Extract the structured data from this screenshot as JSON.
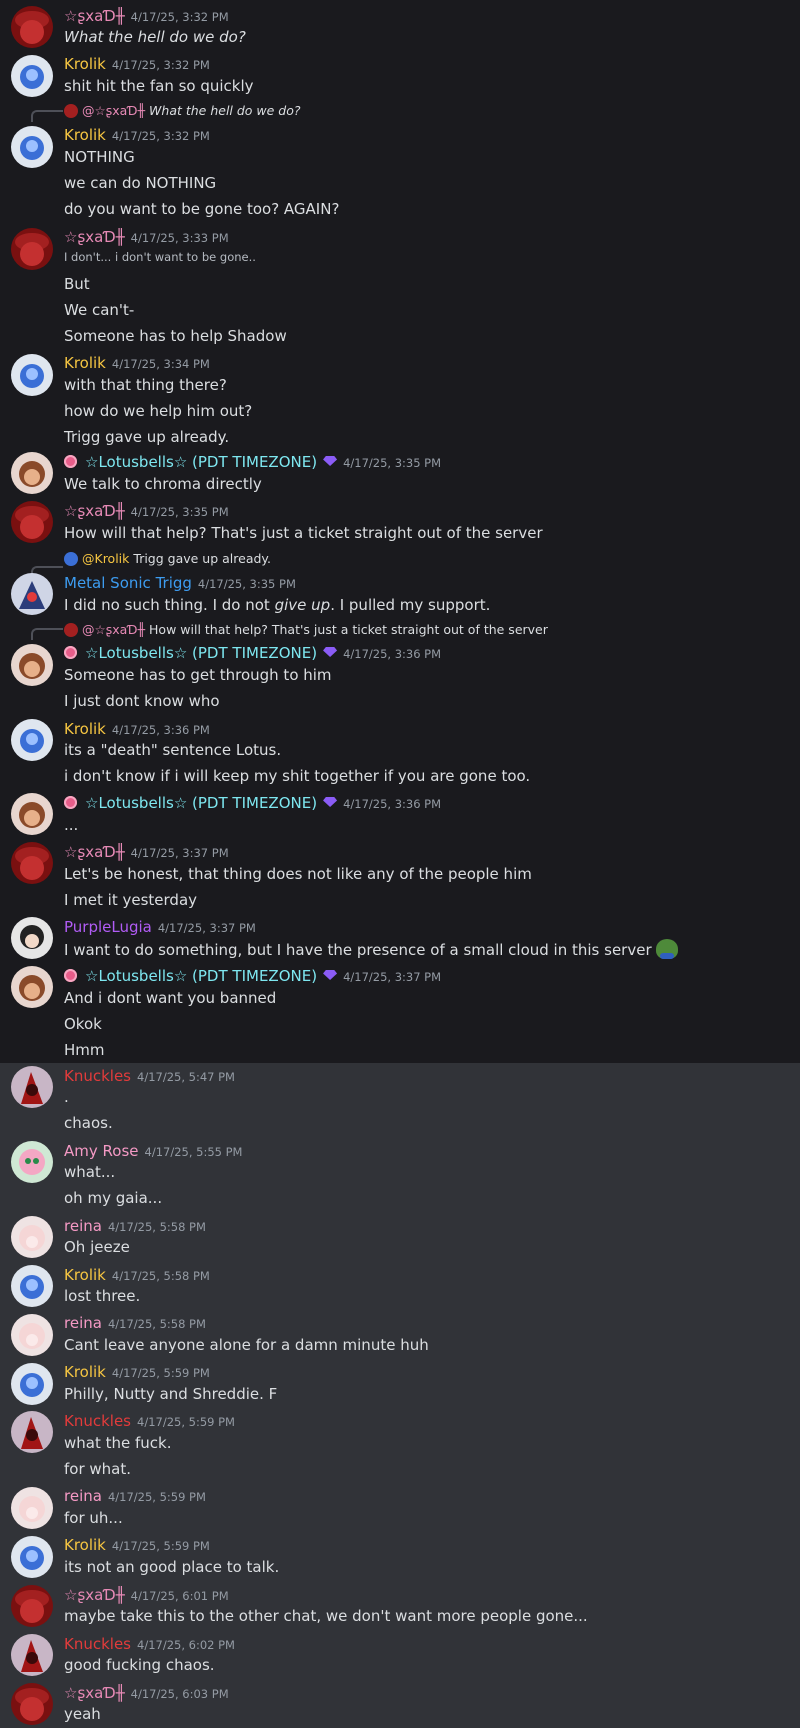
{
  "colors": {
    "background_top": "#1a1a1e",
    "background_bottom": "#313338",
    "sxad": "#e78ab6",
    "krolik": "#f5c542",
    "lotusbells": "#7ee7f0",
    "metal_sonic_trigg": "#3d9cf0",
    "purplelugia": "#b15cf5",
    "knuckles": "#e23b3b",
    "amy_rose": "#f59ac5",
    "reina": "#f59ac5",
    "timestamp": "#949ba4",
    "text": "#dbdee1"
  },
  "messages": [
    {
      "author": "☆ʂxaƊ╫",
      "time": "4/17/25, 3:32 PM",
      "lines": [
        "What the hell do we do?"
      ]
    },
    {
      "author": "Krolik",
      "time": "4/17/25, 3:32 PM",
      "lines": [
        "shit hit the fan so quickly"
      ]
    },
    {
      "reply": {
        "mention": "@☆ʂxaƊ╫",
        "text": "What the hell do we do?"
      },
      "author": "Krolik",
      "time": "4/17/25, 3:32 PM",
      "lines": [
        "NOTHING",
        "we can do NOTHING",
        "do you want to be gone too? AGAIN?"
      ]
    },
    {
      "author": "☆ʂxaƊ╫",
      "time": "4/17/25, 3:33 PM",
      "lines": [
        "I don't... i don't want to be gone..",
        "But",
        "We can't-",
        "Someone has to help Shadow"
      ]
    },
    {
      "author": "Krolik",
      "time": "4/17/25, 3:34 PM",
      "lines": [
        "with that thing there?",
        "how do we help him out?",
        "Trigg gave up already."
      ]
    },
    {
      "author": "☆Lotusbells☆ (PDT TIMEZONE)",
      "time": "4/17/25, 3:35 PM",
      "lines": [
        "We talk to chroma directly"
      ]
    },
    {
      "author": "☆ʂxaƊ╫",
      "time": "4/17/25, 3:35 PM",
      "lines": [
        "How will that help? That's just a ticket straight out of the server"
      ]
    },
    {
      "reply": {
        "mention": "@Krolik",
        "text": "Trigg gave up already."
      },
      "author": "Metal Sonic Trigg",
      "time": "4/17/25, 3:35 PM",
      "lines": [
        "I did no such thing. I do not",
        "give up",
        ". I pulled my support."
      ]
    },
    {
      "reply": {
        "mention": "@☆ʂxaƊ╫",
        "text": "How will that help? That's just a ticket straight out of the server"
      },
      "author": "☆Lotusbells☆ (PDT TIMEZONE)",
      "time": "4/17/25, 3:36 PM",
      "lines": [
        "Someone has to get through to him",
        "I just dont know who"
      ]
    },
    {
      "author": "Krolik",
      "time": "4/17/25, 3:36 PM",
      "lines": [
        "its a \"death\" sentence Lotus.",
        "i don't know if i will keep my shit together if you are gone too."
      ]
    },
    {
      "author": "☆Lotusbells☆ (PDT TIMEZONE)",
      "time": "4/17/25, 3:36 PM",
      "lines": [
        "..."
      ]
    },
    {
      "author": "☆ʂxaƊ╫",
      "time": "4/17/25, 3:37 PM",
      "lines": [
        "Let's be honest, that thing does not like any of the people him",
        "I met it yesterday"
      ]
    },
    {
      "author": "PurpleLugia",
      "time": "4/17/25, 3:37 PM",
      "lines": [
        "I want to do something, but I have the presence of a small cloud in this server"
      ]
    },
    {
      "author": "☆Lotusbells☆ (PDT TIMEZONE)",
      "time": "4/17/25, 3:37 PM",
      "lines": [
        "And i dont want you banned",
        "Okok",
        "Hmm"
      ]
    },
    {
      "author": "Knuckles",
      "time": "4/17/25, 5:47 PM",
      "lines": [
        ".",
        "chaos."
      ]
    },
    {
      "author": "Amy Rose",
      "time": "4/17/25, 5:55 PM",
      "lines": [
        "what...",
        "oh my gaia..."
      ]
    },
    {
      "author": "reina",
      "time": "4/17/25, 5:58 PM",
      "lines": [
        "Oh jeeze"
      ]
    },
    {
      "author": "Krolik",
      "time": "4/17/25, 5:58 PM",
      "lines": [
        "lost three."
      ]
    },
    {
      "author": "reina",
      "time": "4/17/25, 5:58 PM",
      "lines": [
        "Cant leave anyone alone for a damn minute huh"
      ]
    },
    {
      "author": "Krolik",
      "time": "4/17/25, 5:59 PM",
      "lines": [
        "Philly, Nutty and Shreddie. F"
      ]
    },
    {
      "author": "Knuckles",
      "time": "4/17/25, 5:59 PM",
      "lines": [
        "what the fuck.",
        "for what."
      ]
    },
    {
      "author": "reina",
      "time": "4/17/25, 5:59 PM",
      "lines": [
        "for uh..."
      ]
    },
    {
      "author": "Krolik",
      "time": "4/17/25, 5:59 PM",
      "lines": [
        "its not an good place to talk."
      ]
    },
    {
      "author": "☆ʂxaƊ╫",
      "time": "4/17/25, 6:01 PM",
      "lines": [
        "maybe take this to the other chat, we don't want more people gone..."
      ]
    },
    {
      "author": "Knuckles",
      "time": "4/17/25, 6:02 PM",
      "lines": [
        "good fucking chaos."
      ]
    },
    {
      "author": "☆ʂxaƊ╫",
      "time": "4/17/25, 6:03 PM",
      "lines": [
        "yeah"
      ]
    }
  ]
}
